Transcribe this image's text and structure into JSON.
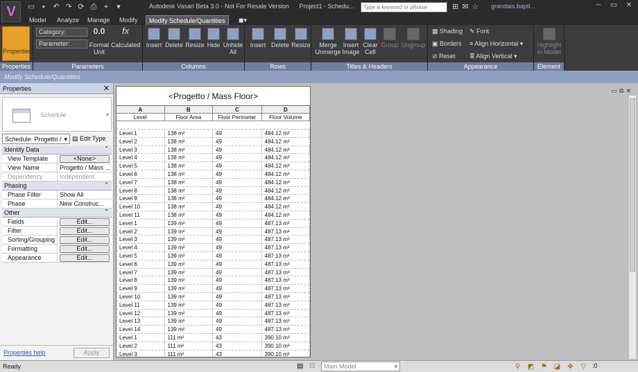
{
  "title": {
    "app": "Autodesk Vasari Beta 3.0 - Not For Resale Version",
    "project": "Project1 - Schedu..."
  },
  "search": {
    "placeholder": "Type a keyword or phrase"
  },
  "user": {
    "name": "grandais.bapti..."
  },
  "tabs": [
    "Model",
    "Analyze",
    "Manage",
    "Modify",
    "Modify Schedule/Quantities"
  ],
  "ribbon": {
    "properties": {
      "label": "Properties",
      "panel": "Properties"
    },
    "parameters": {
      "panel": "Parameters",
      "category": "Category:",
      "parameter": "Parameter:",
      "format_unit": "Format Unit",
      "calculated": "Calculated",
      "format_glyph": "0.0",
      "calc_glyph": "fx"
    },
    "columns": {
      "panel": "Columns",
      "items": [
        "Insert",
        "Delete",
        "Resize",
        "Hide",
        "Unhide All"
      ]
    },
    "rows": {
      "panel": "Rows",
      "items": [
        "Insert",
        "Delete",
        "Resize"
      ]
    },
    "titles": {
      "panel": "Titles & Headers",
      "items": [
        "Merge Unmerge",
        "Insert Image",
        "Clear Cell",
        "Group",
        "Ungroup"
      ]
    },
    "appearance": {
      "panel": "Appearance",
      "shading": "Shading",
      "borders": "Borders",
      "reset": "Reset",
      "font": "Font",
      "align_h": "Align Horizontal",
      "align_v": "Align Vertical"
    },
    "element": {
      "panel": "Element",
      "highlight": "Highlight in Model"
    }
  },
  "context_bar": "Modify Schedule/Quantities",
  "properties_panel": {
    "header": "Properties",
    "type_label": "Schedule",
    "instance_selector": "Schedule: Progetto /",
    "edit_type": "Edit Type",
    "groups": [
      {
        "name": "Identity Data",
        "rows": [
          {
            "key": "View Template",
            "value": "<None>",
            "button": true
          },
          {
            "key": "View Name",
            "value": "Progetto / Mass ...",
            "button": false
          },
          {
            "key": "Dependency",
            "value": "Independent",
            "button": false,
            "dim": true
          }
        ]
      },
      {
        "name": "Phasing",
        "rows": [
          {
            "key": "Phase Filter",
            "value": "Show All",
            "button": false
          },
          {
            "key": "Phase",
            "value": "New Construc...",
            "button": false
          }
        ]
      },
      {
        "name": "Other",
        "rows": [
          {
            "key": "Fields",
            "value": "Edit...",
            "button": true
          },
          {
            "key": "Filter",
            "value": "Edit...",
            "button": true
          },
          {
            "key": "Sorting/Grouping",
            "value": "Edit...",
            "button": true
          },
          {
            "key": "Formatting",
            "value": "Edit...",
            "button": true
          },
          {
            "key": "Appearance",
            "value": "Edit...",
            "button": true
          }
        ]
      }
    ],
    "help_link": "Properties help",
    "apply": "Apply"
  },
  "schedule": {
    "title": "<Progetto / Mass Floor>",
    "letters": [
      "A",
      "B",
      "C",
      "D"
    ],
    "headers": [
      "Level",
      "Floor Area",
      "Floor Perimeter",
      "Floor Volume"
    ],
    "rows": [
      [
        "Level 1",
        "138 m²",
        "49",
        "484.12 m³"
      ],
      [
        "Level 2",
        "138 m²",
        "49",
        "484.12 m³"
      ],
      [
        "Level 3",
        "138 m²",
        "49",
        "484.12 m³"
      ],
      [
        "Level 4",
        "138 m²",
        "49",
        "484.12 m³"
      ],
      [
        "Level 5",
        "138 m²",
        "49",
        "484.12 m³"
      ],
      [
        "Level 6",
        "138 m²",
        "49",
        "484.12 m³"
      ],
      [
        "Level 7",
        "138 m²",
        "49",
        "484.12 m³"
      ],
      [
        "Level 8",
        "138 m²",
        "49",
        "484.12 m³"
      ],
      [
        "Level 9",
        "138 m²",
        "49",
        "484.12 m³"
      ],
      [
        "Level 10",
        "138 m²",
        "49",
        "484.12 m³"
      ],
      [
        "Level 11",
        "138 m²",
        "49",
        "484.12 m³"
      ],
      [
        "Level 1",
        "139 m²",
        "49",
        "487.13 m³"
      ],
      [
        "Level 2",
        "139 m²",
        "49",
        "487.13 m³"
      ],
      [
        "Level 3",
        "139 m²",
        "49",
        "487.13 m³"
      ],
      [
        "Level 4",
        "139 m²",
        "49",
        "487.13 m³"
      ],
      [
        "Level 5",
        "139 m²",
        "49",
        "487.13 m³"
      ],
      [
        "Level 6",
        "139 m²",
        "49",
        "487.13 m³"
      ],
      [
        "Level 7",
        "139 m²",
        "49",
        "487.13 m³"
      ],
      [
        "Level 8",
        "139 m²",
        "49",
        "487.13 m³"
      ],
      [
        "Level 9",
        "139 m²",
        "49",
        "487.13 m³"
      ],
      [
        "Level 10",
        "139 m²",
        "49",
        "487.13 m³"
      ],
      [
        "Level 11",
        "139 m²",
        "49",
        "487.13 m³"
      ],
      [
        "Level 12",
        "139 m²",
        "49",
        "487.13 m³"
      ],
      [
        "Level 13",
        "139 m²",
        "49",
        "487.13 m³"
      ],
      [
        "Level 14",
        "139 m²",
        "49",
        "487.13 m³"
      ],
      [
        "Level 1",
        "111 m²",
        "43",
        "390.10 m³"
      ],
      [
        "Level 2",
        "111 m²",
        "43",
        "390.10 m³"
      ],
      [
        "Level 3",
        "111 m²",
        "43",
        "390.10 m³"
      ]
    ]
  },
  "status": {
    "text": "Ready",
    "model": "Main Model",
    "filter_count": ":0"
  }
}
